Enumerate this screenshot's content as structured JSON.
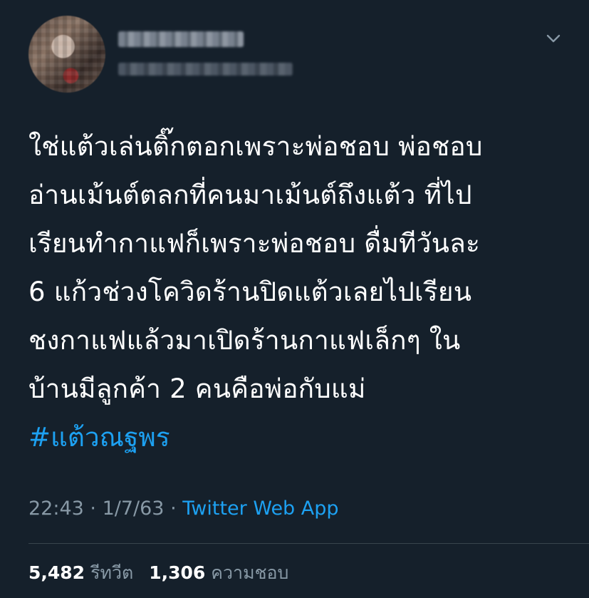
{
  "tweet": {
    "author": {
      "display_name": "",
      "handle": ""
    },
    "menu_icon": "chevron-down-icon",
    "text_lines": [
      " ใช่แต้วเล่นติ๊กตอกเพราะพ่อชอบ พ่อชอบ",
      "อ่านเม้นต์ตลกที่คนมาเม้นต์ถึงแต้ว ที่ไป",
      "เรียนทำกาแฟก็เพราะพ่อชอบ ดื่มทีวันละ",
      "6 แก้วช่วงโควิดร้านปิดแต้วเลยไปเรียน",
      "ชงกาแฟแล้วมาเปิดร้านกาแฟเล็กๆ ใน",
      "บ้านมีลูกค้า 2 คนคือพ่อกับแม่"
    ],
    "hashtag": "#แต้วณฐพร",
    "time": "22:43",
    "date": "1/7/63",
    "separator": "·",
    "source": "Twitter Web App",
    "retweets_count": "5,482",
    "retweets_label": "รีทวีต",
    "likes_count": "1,306",
    "likes_label": "ความชอบ"
  },
  "colors": {
    "background": "#15202b",
    "text": "#ffffff",
    "secondary": "#8899a6",
    "link": "#1da1f2",
    "divider": "#38444d"
  }
}
